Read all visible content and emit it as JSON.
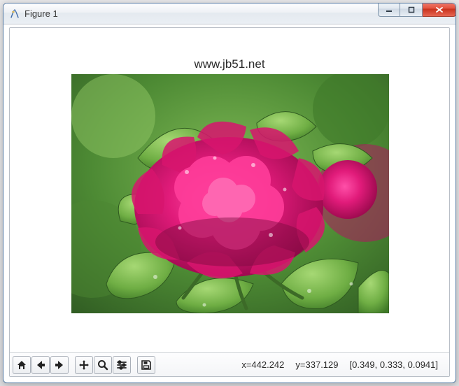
{
  "window": {
    "title": "Figure 1",
    "controls": {
      "minimize_tooltip": "Minimize",
      "maximize_tooltip": "Maximize",
      "close_tooltip": "Close"
    }
  },
  "plot": {
    "title": "www.jb51.net",
    "image_desc": "Photograph of a large magenta-pink peony flower with green leaves, water droplets visible, blurred green foliage background."
  },
  "toolbar": {
    "home_tooltip": "Home",
    "back_tooltip": "Back",
    "forward_tooltip": "Forward",
    "pan_tooltip": "Pan",
    "zoom_tooltip": "Zoom",
    "configure_tooltip": "Configure subplots",
    "save_tooltip": "Save"
  },
  "status": {
    "x_label": "x=442.242",
    "y_label": "y=337.129",
    "rgb": "[0.349, 0.333, 0.0941]"
  }
}
